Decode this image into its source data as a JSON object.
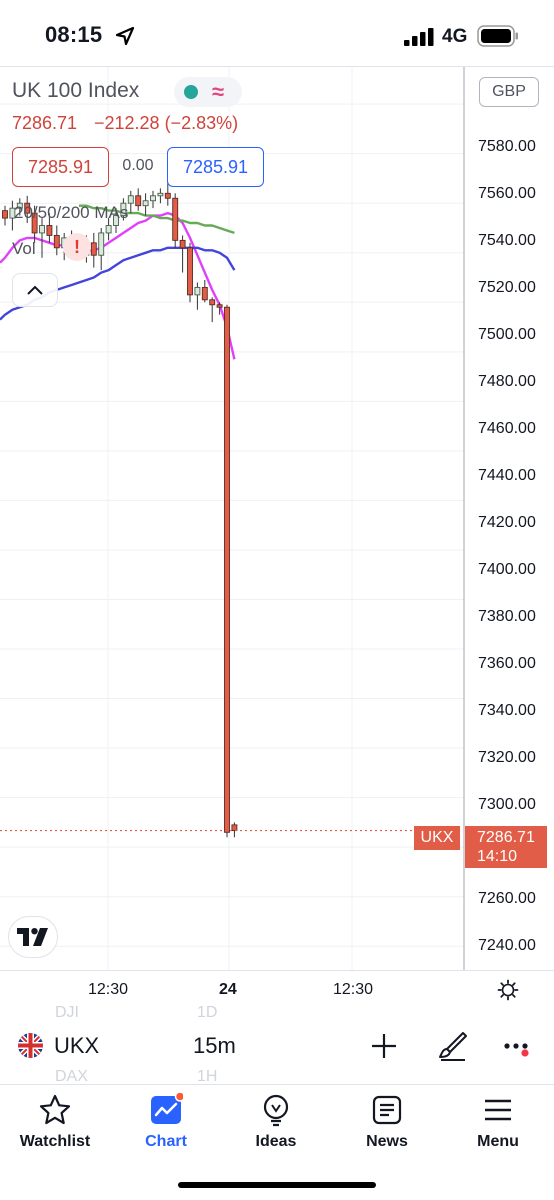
{
  "status": {
    "time": "08:15",
    "network": "4G"
  },
  "chart": {
    "title": "UK 100 Index",
    "price": "7286.71",
    "change": "−212.28 (−2.83%)",
    "bid": "7285.91",
    "spread": "0.00",
    "ask": "7285.91",
    "indicator_label": "20/50/200 MAs",
    "volume_label": "Vol",
    "alert_symbol": "!",
    "currency": "GBP",
    "y_ticks": [
      "7580.00",
      "7560.00",
      "7540.00",
      "7520.00",
      "7500.00",
      "7480.00",
      "7460.00",
      "7440.00",
      "7420.00",
      "7400.00",
      "7380.00",
      "7360.00",
      "7340.00",
      "7320.00",
      "7300.00",
      "7260.00",
      "7240.00"
    ],
    "last_symbol": "UKX",
    "last_price": "7286.71",
    "countdown": "14:10",
    "x_ticks": [
      "12:30",
      "24",
      "12:30"
    ],
    "colors": {
      "up": "#26a69a",
      "down": "#e15d48",
      "ma20": "#e040fb",
      "ma50": "#4444dd",
      "ma200": "#66aa55",
      "price_line": "#e15d48"
    }
  },
  "chart_data": {
    "type": "candlestick",
    "title": "UK 100 Index",
    "interval": "15m",
    "currency": "GBP",
    "ylim": [
      7230,
      7595
    ],
    "x_ticks": [
      "12:30",
      "24",
      "12:30"
    ],
    "candles": [
      {
        "o": 7537,
        "h": 7539,
        "l": 7531,
        "c": 7534
      },
      {
        "o": 7534,
        "h": 7541,
        "l": 7529,
        "c": 7538
      },
      {
        "o": 7538,
        "h": 7542,
        "l": 7535,
        "c": 7540
      },
      {
        "o": 7540,
        "h": 7543,
        "l": 7532,
        "c": 7536
      },
      {
        "o": 7536,
        "h": 7539,
        "l": 7524,
        "c": 7528
      },
      {
        "o": 7528,
        "h": 7534,
        "l": 7518,
        "c": 7531
      },
      {
        "o": 7531,
        "h": 7536,
        "l": 7524,
        "c": 7527
      },
      {
        "o": 7527,
        "h": 7531,
        "l": 7519,
        "c": 7522
      },
      {
        "o": 7522,
        "h": 7528,
        "l": 7517,
        "c": 7526
      },
      {
        "o": 7526,
        "h": 7529,
        "l": 7520,
        "c": 7523
      },
      {
        "o": 7523,
        "h": 7526,
        "l": 7517,
        "c": 7519
      },
      {
        "o": 7519,
        "h": 7527,
        "l": 7516,
        "c": 7524
      },
      {
        "o": 7524,
        "h": 7528,
        "l": 7514,
        "c": 7519
      },
      {
        "o": 7519,
        "h": 7530,
        "l": 7513,
        "c": 7528
      },
      {
        "o": 7528,
        "h": 7534,
        "l": 7525,
        "c": 7531
      },
      {
        "o": 7531,
        "h": 7538,
        "l": 7528,
        "c": 7535
      },
      {
        "o": 7535,
        "h": 7542,
        "l": 7533,
        "c": 7540
      },
      {
        "o": 7540,
        "h": 7545,
        "l": 7536,
        "c": 7543
      },
      {
        "o": 7543,
        "h": 7546,
        "l": 7537,
        "c": 7539
      },
      {
        "o": 7539,
        "h": 7544,
        "l": 7535,
        "c": 7541
      },
      {
        "o": 7541,
        "h": 7545,
        "l": 7538,
        "c": 7543
      },
      {
        "o": 7543,
        "h": 7546,
        "l": 7540,
        "c": 7544
      },
      {
        "o": 7544,
        "h": 7549,
        "l": 7539,
        "c": 7542
      },
      {
        "o": 7542,
        "h": 7544,
        "l": 7522,
        "c": 7525
      },
      {
        "o": 7525,
        "h": 7527,
        "l": 7512,
        "c": 7522
      },
      {
        "o": 7522,
        "h": 7524,
        "l": 7500,
        "c": 7503
      },
      {
        "o": 7503,
        "h": 7508,
        "l": 7497,
        "c": 7506
      },
      {
        "o": 7506,
        "h": 7509,
        "l": 7500,
        "c": 7501
      },
      {
        "o": 7501,
        "h": 7502,
        "l": 7492,
        "c": 7499
      },
      {
        "o": 7499,
        "h": 7500,
        "l": 7495,
        "c": 7498
      },
      {
        "o": 7498,
        "h": 7499,
        "l": 7284,
        "c": 7286
      },
      {
        "o": 7289,
        "h": 7290,
        "l": 7284,
        "c": 7286.71
      }
    ],
    "series": [
      {
        "name": "20",
        "values": [
          7518,
          7522,
          7525,
          7526,
          7526,
          7525,
          7524,
          7523,
          7523,
          7522,
          7522,
          7521,
          7521,
          7522,
          7524,
          7526,
          7528,
          7530,
          7532,
          7533,
          7535,
          7535,
          7536,
          7535,
          7532,
          7526,
          7519,
          7512,
          7505,
          7499,
          7490,
          7477
        ]
      },
      {
        "name": "50",
        "values": [
          7495,
          7497,
          7498,
          7499,
          7501,
          7502,
          7504,
          7505,
          7506,
          7507,
          7508,
          7509,
          7510,
          7512,
          7513,
          7515,
          7517,
          7518,
          7519,
          7520,
          7521,
          7521,
          7522,
          7522,
          7522,
          7522,
          7522,
          7521,
          7521,
          7520,
          7518,
          7513
        ]
      },
      {
        "name": "200",
        "values": [
          null,
          null,
          null,
          null,
          null,
          null,
          null,
          null,
          null,
          null,
          7539,
          7539,
          7538,
          7538,
          7537,
          7537,
          7536,
          7536,
          7536,
          7535,
          7535,
          7534,
          7534,
          7533,
          7533,
          7532,
          7532,
          7531,
          7531,
          7530,
          7529,
          7528
        ]
      }
    ],
    "last_price": 7286.71
  },
  "toolbar": {
    "symbol": "UKX",
    "interval": "15m",
    "ghost_top_left": "DJI",
    "ghost_top_mid": "1D",
    "ghost_bottom_left": "DAX",
    "ghost_bottom_mid": "1H"
  },
  "nav": [
    {
      "label": "Watchlist"
    },
    {
      "label": "Chart"
    },
    {
      "label": "Ideas"
    },
    {
      "label": "News"
    },
    {
      "label": "Menu"
    }
  ]
}
